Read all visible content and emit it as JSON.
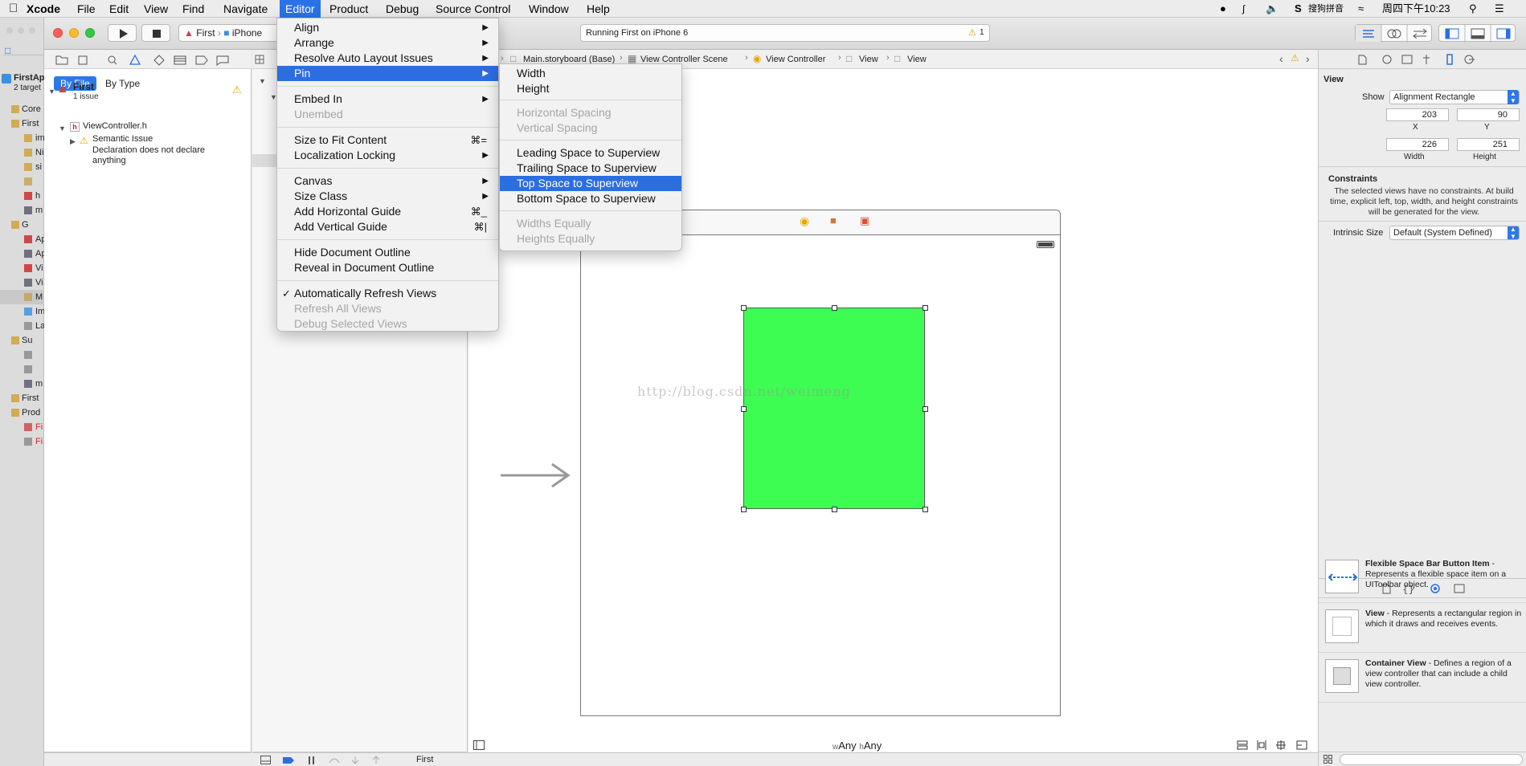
{
  "menubar": {
    "app": "Xcode",
    "items": [
      "File",
      "Edit",
      "View",
      "Find",
      "Navigate",
      "Editor",
      "Product",
      "Debug",
      "Source Control",
      "Window",
      "Help"
    ],
    "active": "Editor",
    "status_input": "搜狗拼音",
    "clock": "周四下午10:23"
  },
  "toolbar": {
    "scheme": "First",
    "device": "iPhone",
    "status_text": "Running First on iPhone 6",
    "warning_count": "1"
  },
  "back_window": {
    "project": "FirstAp",
    "targets": "2 target",
    "files": [
      "Core",
      "First",
      "im",
      "Ni",
      "si",
      "",
      "h",
      "m",
      "G",
      "Ap",
      "Ap",
      "Vi",
      "Vi",
      "M",
      "Im",
      "La",
      "Su",
      "",
      "",
      "m",
      "First",
      "Prod",
      "Fi",
      "Fi"
    ]
  },
  "navigator": {
    "tab_by_file": "By File",
    "tab_by_type": "By Type",
    "project": "First",
    "issue_count": "1 issue",
    "file": "ViewController.h",
    "issue_title": "Semantic Issue",
    "issue_detail": "Declaration does not declare anything"
  },
  "jumpbar": {
    "items": [
      "Main.storyboard (Base)",
      "View Controller Scene",
      "View Controller",
      "View",
      "View"
    ]
  },
  "editor_menu": {
    "items": [
      {
        "label": "Align",
        "submenu": true
      },
      {
        "label": "Arrange",
        "submenu": true
      },
      {
        "label": "Resolve Auto Layout Issues",
        "submenu": true
      },
      {
        "label": "Pin",
        "submenu": true,
        "highlighted": true
      },
      {
        "label": "Embed In",
        "submenu": true
      },
      {
        "label": "Unembed",
        "disabled": true
      },
      {
        "label": "Size to Fit Content",
        "shortcut": "⌘="
      },
      {
        "label": "Localization Locking",
        "submenu": true
      },
      {
        "label": "Canvas",
        "submenu": true
      },
      {
        "label": "Size Class",
        "submenu": true
      },
      {
        "label": "Add Horizontal Guide",
        "shortcut": "⌘_"
      },
      {
        "label": "Add Vertical Guide",
        "shortcut": "⌘|"
      },
      {
        "label": "Hide Document Outline"
      },
      {
        "label": "Reveal in Document Outline"
      },
      {
        "label": "Automatically Refresh Views",
        "checked": true
      },
      {
        "label": "Refresh All Views",
        "disabled": true
      },
      {
        "label": "Debug Selected Views",
        "disabled": true
      }
    ]
  },
  "pin_menu": {
    "items": [
      {
        "label": "Width"
      },
      {
        "label": "Height"
      },
      {
        "label": "Horizontal Spacing",
        "disabled": true
      },
      {
        "label": "Vertical Spacing",
        "disabled": true
      },
      {
        "label": "Leading Space to Superview"
      },
      {
        "label": "Trailing Space to Superview"
      },
      {
        "label": "Top Space to Superview",
        "highlighted": true
      },
      {
        "label": "Bottom Space to Superview"
      },
      {
        "label": "Widths Equally",
        "disabled": true
      },
      {
        "label": "Heights Equally",
        "disabled": true
      }
    ]
  },
  "canvas": {
    "watermark": "http://blog.csdn.net/weimeng",
    "size_class_w": "w",
    "size_class_w_val": "Any",
    "size_class_h": "h",
    "size_class_h_val": "Any",
    "green_color": "#3dfc52"
  },
  "inspector": {
    "section": "View",
    "show_label": "Show",
    "show_value": "Alignment Rectangle",
    "x": "203",
    "y": "90",
    "x_label": "X",
    "y_label": "Y",
    "width": "226",
    "height": "251",
    "width_label": "Width",
    "height_label": "Height",
    "constraints_title": "Constraints",
    "constraints_text": "The selected views have no constraints. At build time, explicit left, top, width, and height constraints will be generated for the view.",
    "intrinsic_label": "Intrinsic Size",
    "intrinsic_value": "Default (System Defined)"
  },
  "library": {
    "items": [
      {
        "title": "Flexible Space Bar Button Item",
        "desc": " - Represents a flexible space item on a UIToolbar object."
      },
      {
        "title": "View",
        "desc": " - Represents a rectangular region in which it draws and receives events."
      },
      {
        "title": "Container View",
        "desc": " - Defines a region of a view controller that can include a child view controller."
      }
    ]
  },
  "debugbar": {
    "target": "First"
  }
}
